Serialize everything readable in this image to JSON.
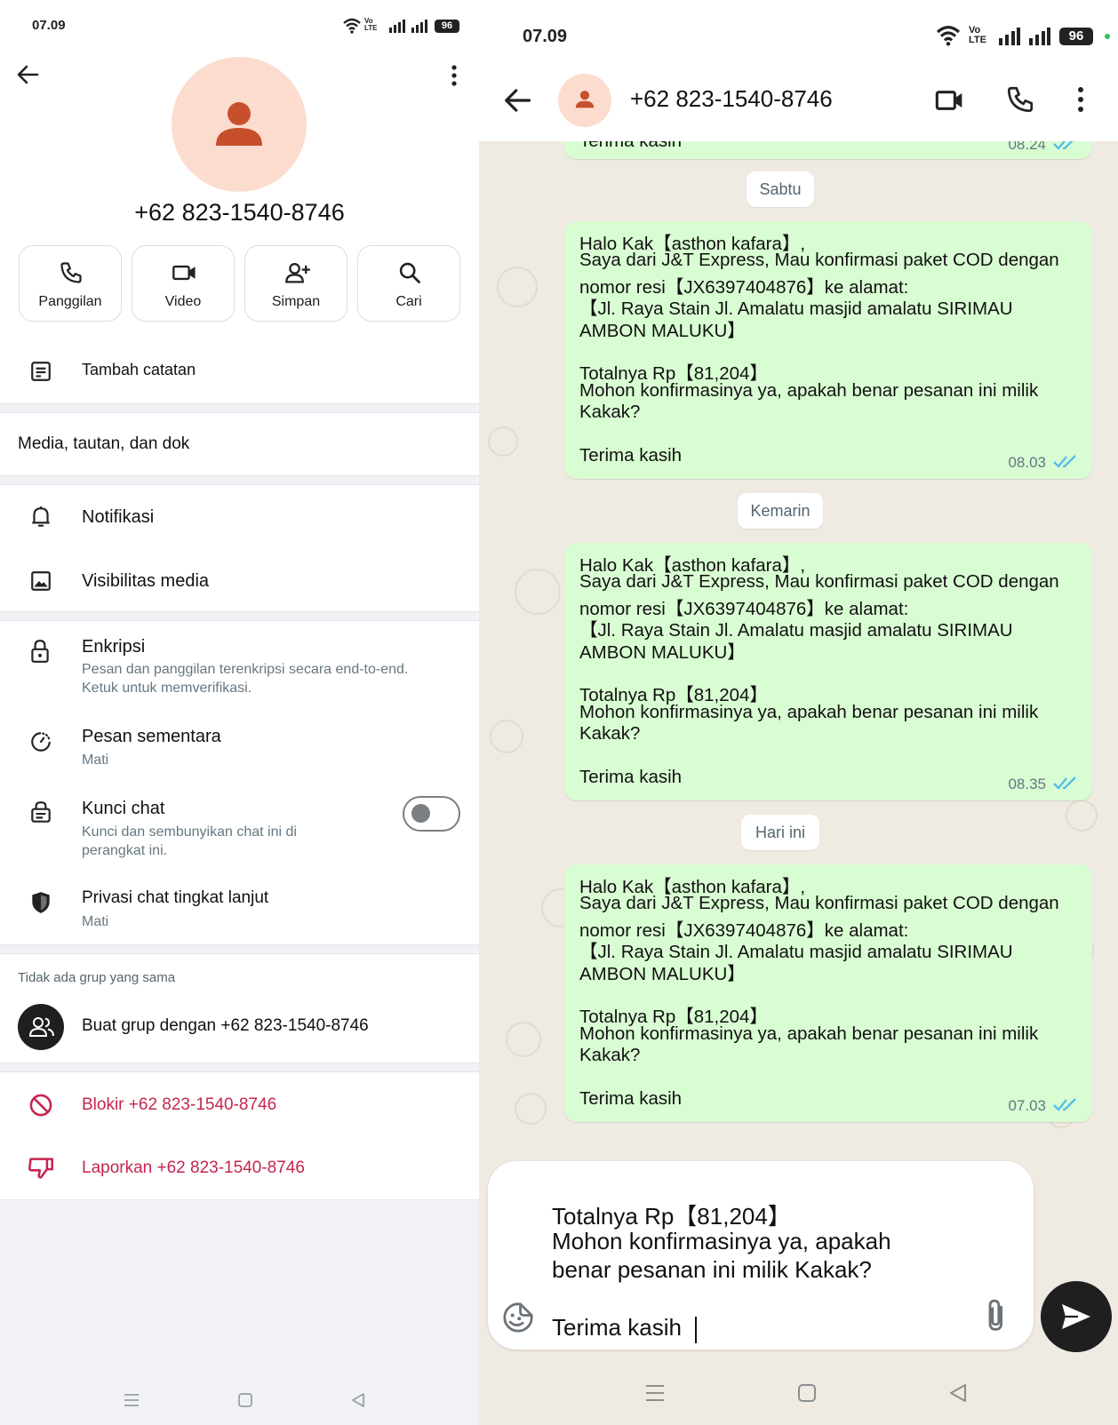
{
  "left": {
    "status": {
      "time": "07.09",
      "battery": "96"
    },
    "contact": {
      "name": "+62 823-1540-8746"
    },
    "actions": [
      {
        "label": "Panggilan",
        "icon": "phone-icon"
      },
      {
        "label": "Video",
        "icon": "video-icon"
      },
      {
        "label": "Simpan",
        "icon": "add-person-icon"
      },
      {
        "label": "Cari",
        "icon": "search-icon"
      }
    ],
    "add_note": "Tambah catatan",
    "media_links": "Media, tautan, dan dok",
    "notifications": "Notifikasi",
    "media_visibility": "Visibilitas media",
    "encryption": {
      "title": "Enkripsi",
      "subtitle": "Pesan dan panggilan terenkripsi secara end-to-end. Ketuk untuk memverifikasi."
    },
    "disappearing": {
      "title": "Pesan sementara",
      "subtitle": "Mati"
    },
    "chat_lock": {
      "title": "Kunci chat",
      "subtitle": "Kunci dan sembunyikan chat ini di perangkat ini.",
      "enabled": false
    },
    "advanced_privacy": {
      "title": "Privasi chat tingkat lanjut",
      "subtitle": "Mati"
    },
    "groups": {
      "header": "Tidak ada grup yang sama",
      "create": "Buat grup dengan +62 823-1540-8746"
    },
    "block": "Blokir +62 823-1540-8746",
    "report": "Laporkan +62 823-1540-8746",
    "colors": {
      "danger": "#c4264e",
      "avatar_bg": "#fcdccf",
      "avatar_fg": "#c84f2c"
    }
  },
  "right": {
    "status": {
      "time": "07.09",
      "battery": "96"
    },
    "header": {
      "name": "+62 823-1540-8746"
    },
    "partial_message": {
      "text": "Terima kasih",
      "time": "08.24"
    },
    "messages": [
      {
        "date": "Sabtu",
        "lines": [
          "Halo Kak【asthon kafara】,",
          "Saya dari J&T Express, Mau konfirmasi paket COD dengan",
          "nomor resi【JX6397404876】ke alamat:",
          "【Jl. Raya Stain Jl. Amalatu  masjid amalatu SIRIMAU",
          "AMBON MALUKU】",
          "",
          "Totalnya Rp【81,204】",
          "Mohon konfirmasinya ya, apakah benar pesanan ini milik",
          "Kakak?",
          "",
          "Terima kasih"
        ],
        "time": "08.03"
      },
      {
        "date": "Kemarin",
        "lines": [
          "Halo Kak【asthon kafara】,",
          "Saya dari J&T Express, Mau konfirmasi paket COD dengan",
          "nomor resi【JX6397404876】ke alamat:",
          "【Jl. Raya Stain Jl. Amalatu  masjid amalatu SIRIMAU",
          "AMBON MALUKU】",
          "",
          "Totalnya Rp【81,204】",
          "Mohon konfirmasinya ya, apakah benar pesanan ini milik",
          "Kakak?",
          "",
          "Terima kasih"
        ],
        "time": "08.35"
      },
      {
        "date": "Hari ini",
        "lines": [
          "Halo Kak【asthon kafara】,",
          "Saya dari J&T Express, Mau konfirmasi paket COD dengan",
          "nomor resi【JX6397404876】ke alamat:",
          "【Jl. Raya Stain Jl. Amalatu  masjid amalatu SIRIMAU",
          "AMBON MALUKU】",
          "",
          "Totalnya Rp【81,204】",
          "Mohon konfirmasinya ya, apakah benar pesanan ini milik",
          "Kakak?",
          "",
          "Terima kasih"
        ],
        "time": "07.03"
      }
    ],
    "composer": {
      "lines": [
        "Totalnya Rp【81,204】",
        "Mohon konfirmasinya ya, apakah",
        "benar pesanan ini milik Kakak?",
        "",
        "Terima kasih"
      ]
    },
    "colors": {
      "bubble": "#d9fdd3",
      "tick": "#53bdeb",
      "chat_bg": "#efeae2"
    }
  }
}
